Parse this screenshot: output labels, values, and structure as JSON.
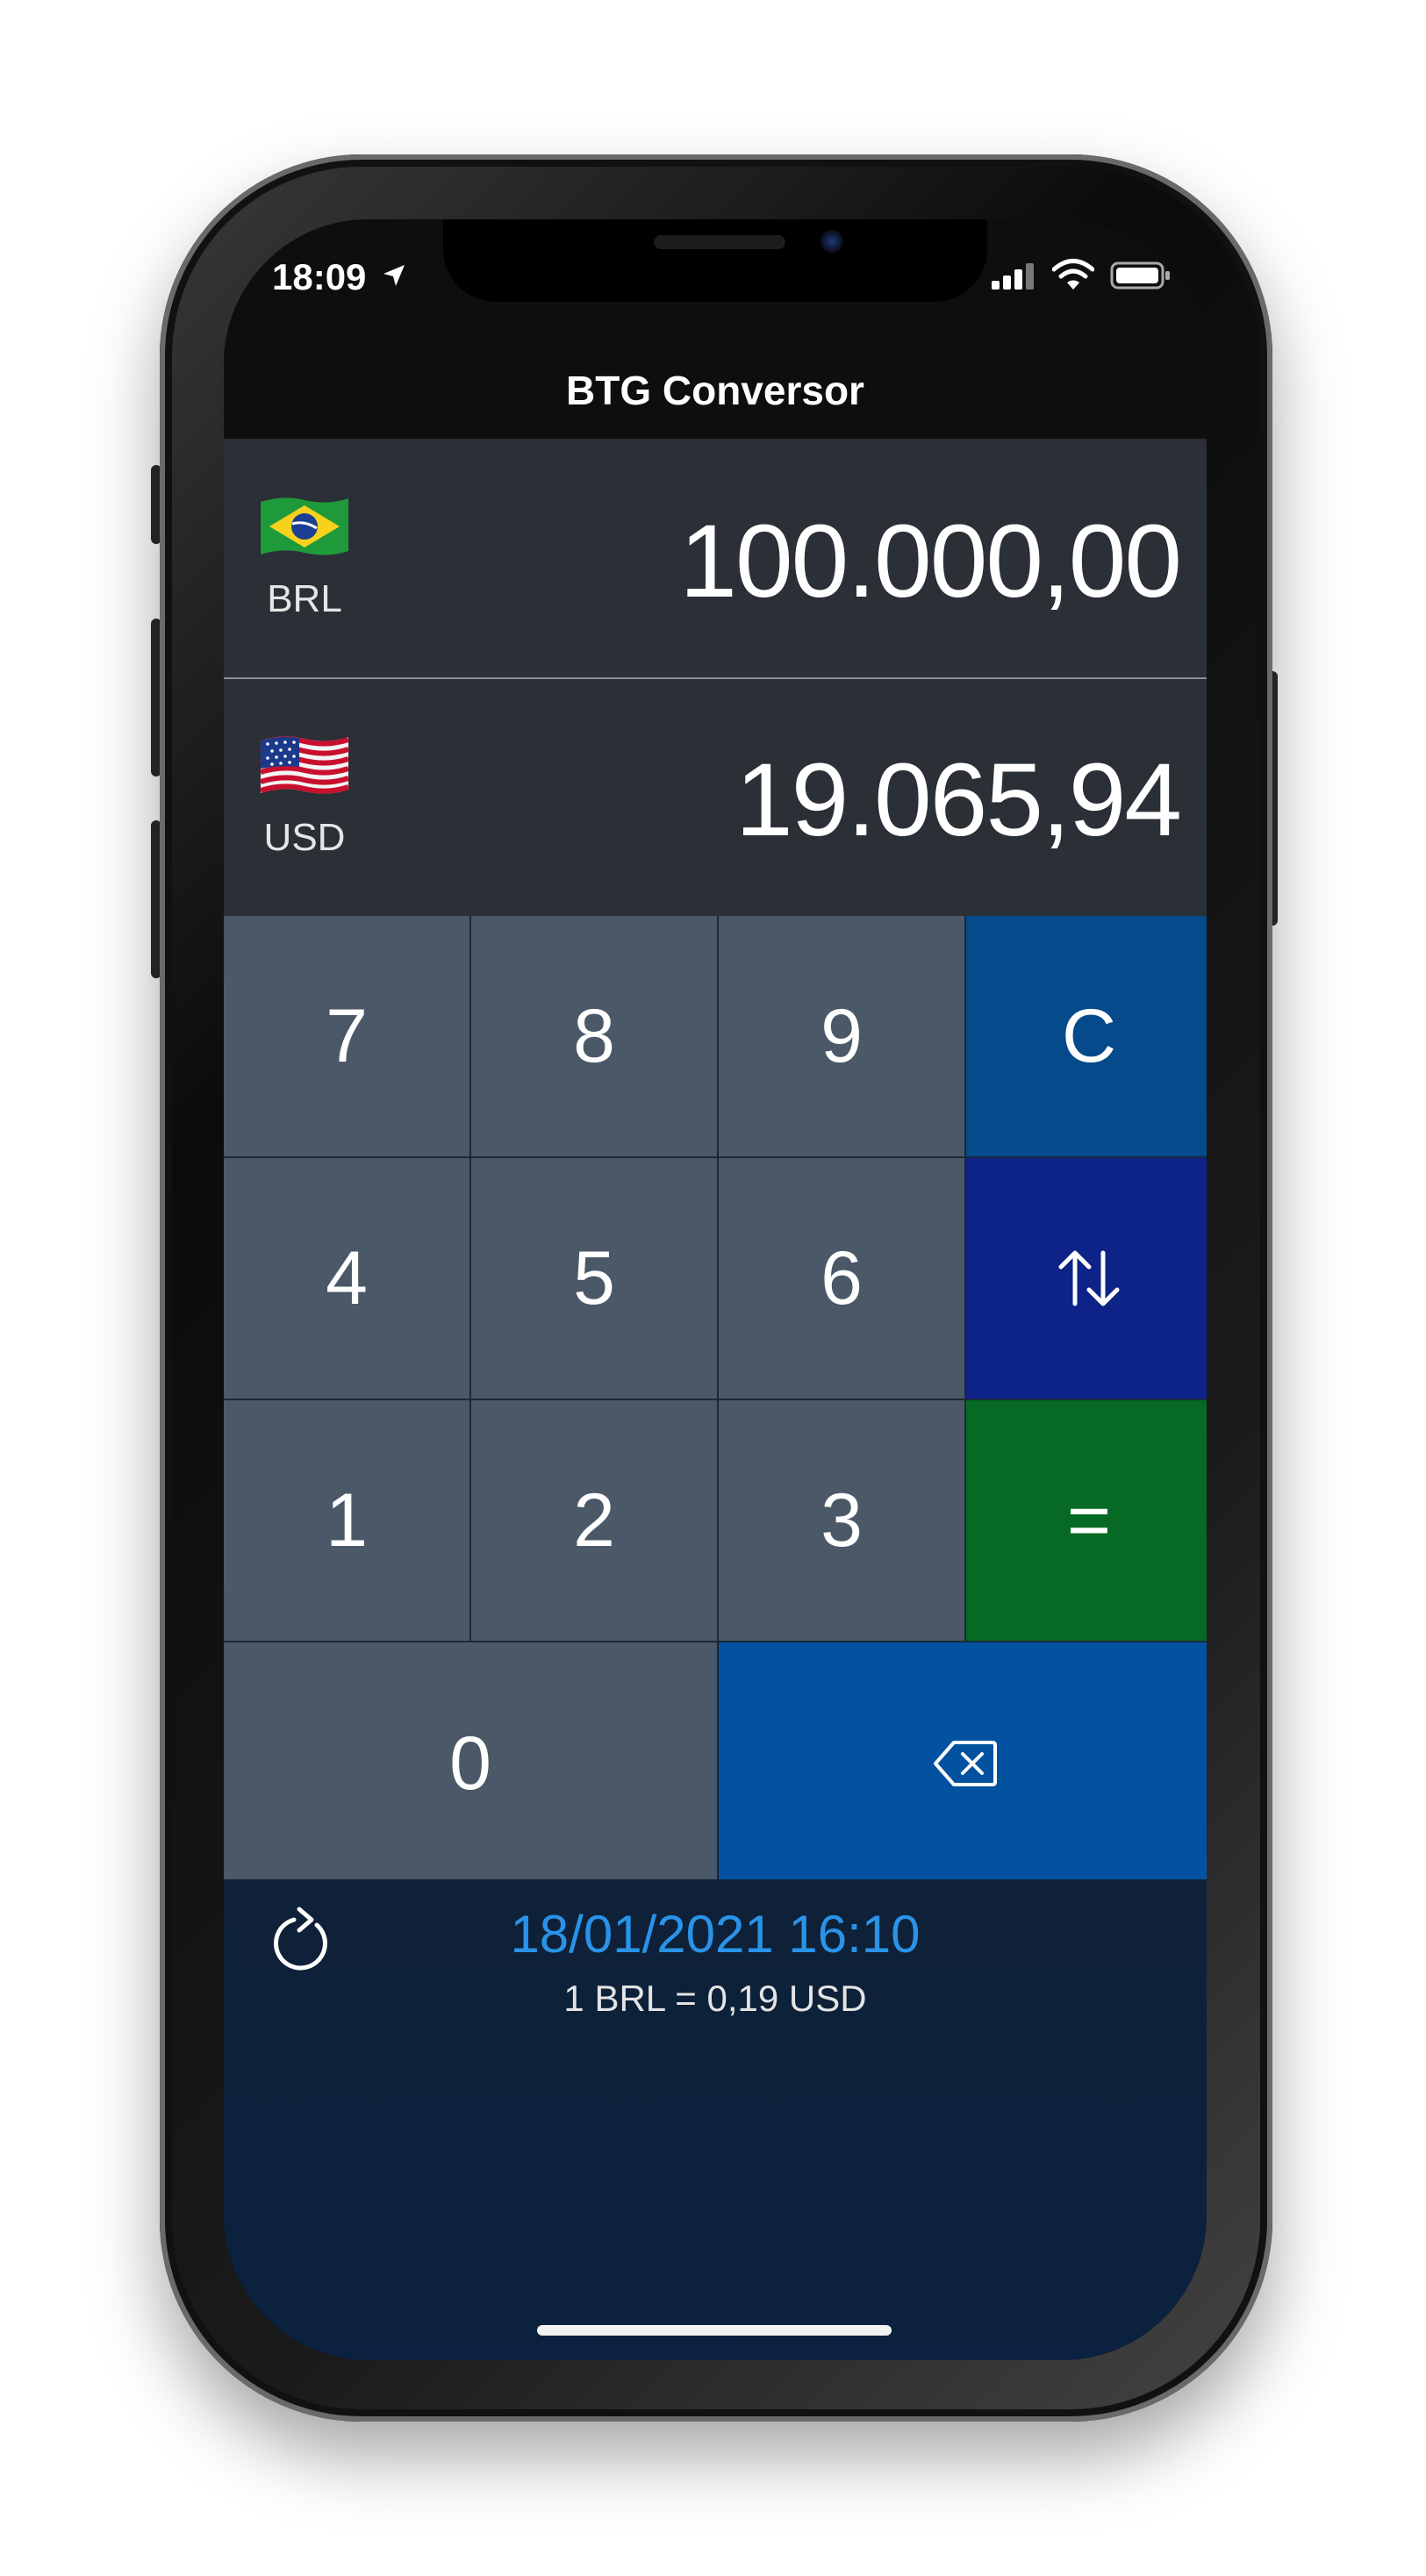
{
  "status_bar": {
    "time": "18:09"
  },
  "app": {
    "title": "BTG Conversor"
  },
  "currencies": [
    {
      "code": "BRL",
      "amount": "100.000,00",
      "flag": "brazil-flag"
    },
    {
      "code": "USD",
      "amount": "19.065,94",
      "flag": "us-flag"
    }
  ],
  "keypad": {
    "k7": "7",
    "k8": "8",
    "k9": "9",
    "clear": "C",
    "k4": "4",
    "k5": "5",
    "k6": "6",
    "swap": "⇅",
    "k1": "1",
    "k2": "2",
    "k3": "3",
    "equals": "=",
    "k0": "0",
    "backspace": "backspace-icon"
  },
  "footer": {
    "updated_at": "18/01/2021 16:10",
    "rate": "1 BRL =  0,19 USD"
  },
  "colors": {
    "key": "#4a5868",
    "clear": "#054a8a",
    "swap": "#0e2388",
    "equals": "#066a25",
    "backspace": "#0352a0",
    "accent": "#2a93e8"
  }
}
